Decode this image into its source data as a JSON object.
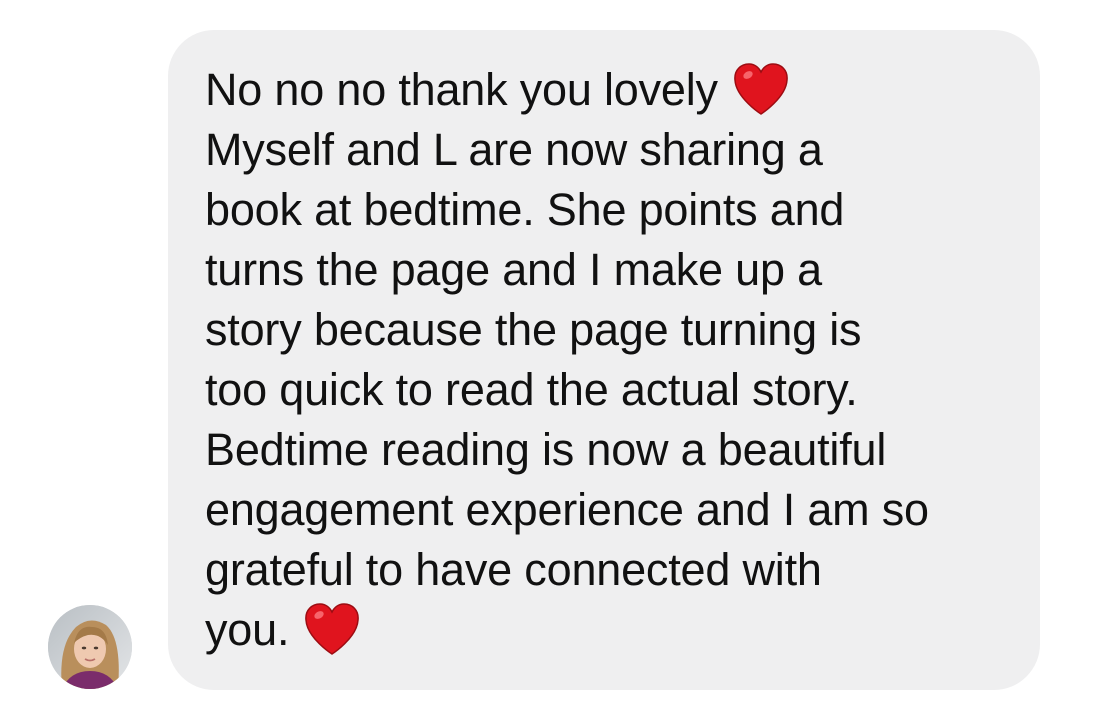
{
  "message": {
    "lines": [
      "No no no thank you lovely",
      "Myself and L are now sharing a",
      "book at bedtime. She points and",
      "turns the page and I make up a",
      "story because the page turning is",
      "too quick to read the actual story.",
      "Bedtime reading is now a beautiful",
      "engagement experience and I am so",
      "grateful to have connected with",
      "you."
    ],
    "emoji": "red-heart-icon",
    "heart_color": "#e0141e",
    "bubble_color": "#efeff0",
    "text_color": "#111111"
  }
}
